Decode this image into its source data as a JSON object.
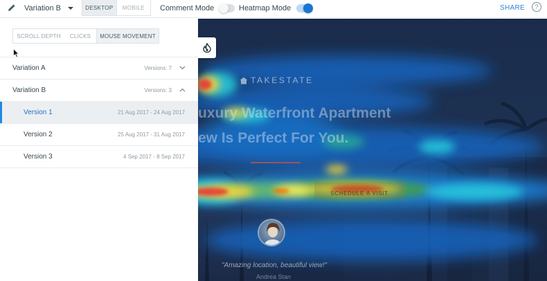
{
  "toolbar": {
    "edit_icon": "pencil-icon",
    "variation_label": "Variation B",
    "device_desktop": "DESKTOP",
    "device_mobile": "MOBILE",
    "comment_mode_label": "Comment Mode",
    "comment_mode_on": false,
    "heatmap_mode_label": "Heatmap Mode",
    "heatmap_mode_on": true,
    "share_label": "SHARE",
    "help_symbol": "?"
  },
  "panel": {
    "modes": [
      "SCROLL DEPTH",
      "CLICKS",
      "MOUSE MOVEMENT"
    ],
    "active_mode": "MOUSE MOVEMENT",
    "variations": [
      {
        "label": "Variation A",
        "versions_label": "Versions: 7",
        "expanded": false
      },
      {
        "label": "Variation B",
        "versions_label": "Versions: 3",
        "expanded": true,
        "versions": [
          {
            "label": "Version 1",
            "dates": "21 Aug 2017 - 24 Aug 2017",
            "selected": true
          },
          {
            "label": "Version 2",
            "dates": "25 Aug 2017 - 31 Aug 2017",
            "selected": false
          },
          {
            "label": "Version 3",
            "dates": "4 Sep 2017 - 8 Sep 2017",
            "selected": false
          }
        ]
      }
    ]
  },
  "preview": {
    "brand": "TAKESTATE",
    "headline_line1": "uxury Waterfront Apartment",
    "headline_line2": "ew Is Perfect For You.",
    "cta": "SCHEDULE A VISIT",
    "quote": "\"Amazing location, beautiful view!\"",
    "author": "Andrea Stan",
    "heatmap_toggle_icon": "flame-icon"
  },
  "colors": {
    "accent": "#1976d2",
    "share": "#2f7fd5",
    "selected_row_bg": "#eceff1",
    "heat_hot": "#e53935",
    "heat_warm": "#fdd835",
    "heat_cool": "#1565c0"
  }
}
